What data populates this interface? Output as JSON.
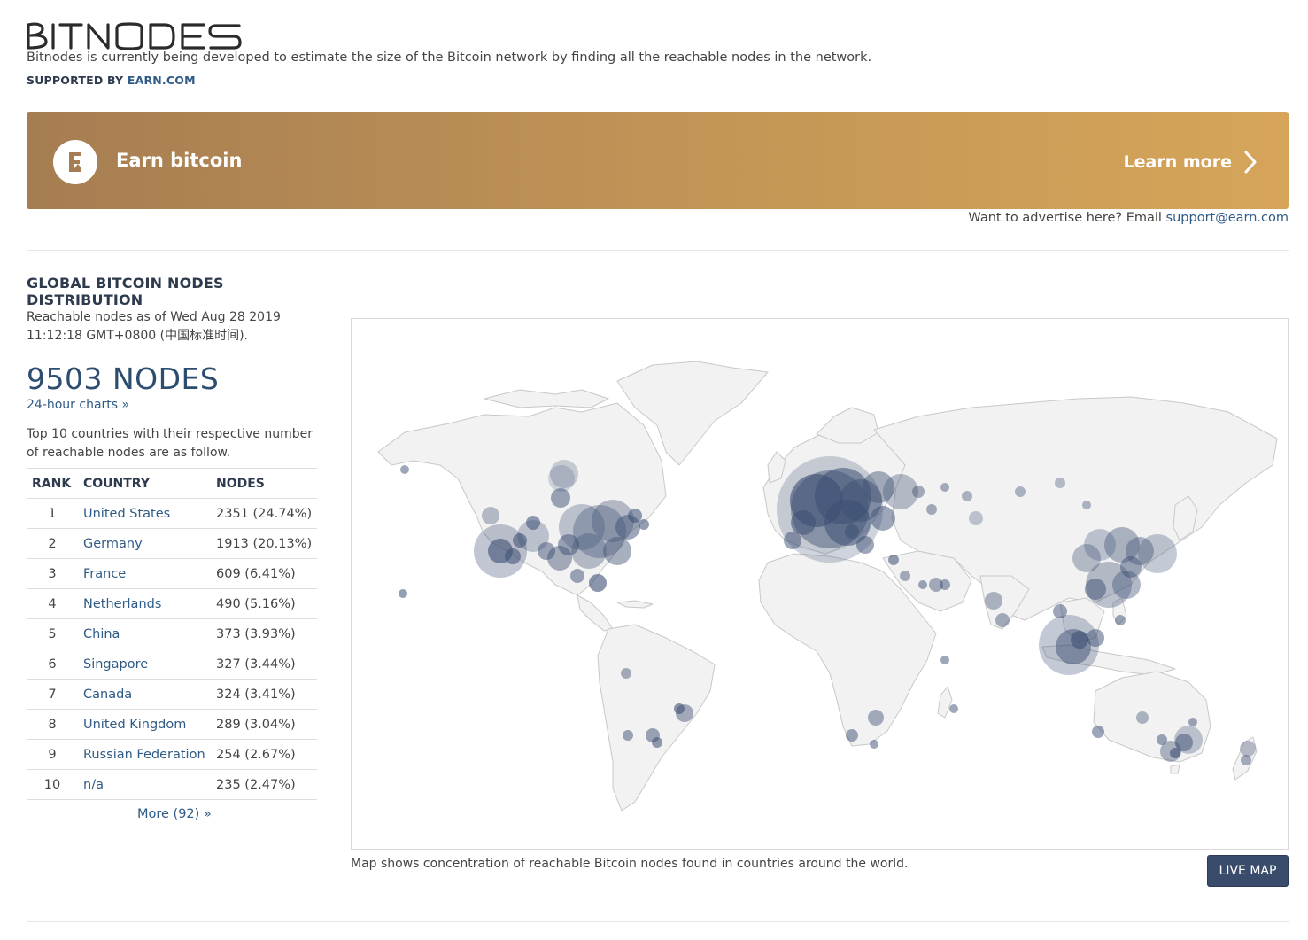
{
  "header": {
    "brand": "BITNODES",
    "tagline": "Bitnodes is currently being developed to estimate the size of the Bitcoin network by finding all the reachable nodes in the network.",
    "supported_prefix": "SUPPORTED BY",
    "supported_link": "EARN.COM"
  },
  "banner": {
    "title": "Earn bitcoin",
    "cta": "Learn more",
    "advertise_text": "Want to advertise here? Email",
    "advertise_email": "support@earn.com",
    "gradient_start": "#a67d52",
    "gradient_end": "#d6a55a"
  },
  "distribution": {
    "title": "GLOBAL BITCOIN NODES DISTRIBUTION",
    "reachable_line1": "Reachable nodes as of Wed Aug 28 2019",
    "reachable_line2": "11:12:18 GMT+0800 (中国标准时间).",
    "total": "9503 NODES",
    "charts_link": "24-hour charts »",
    "intro": "Top 10 countries with their respective number of reachable nodes are as follow.",
    "columns": [
      "RANK",
      "COUNTRY",
      "NODES"
    ],
    "rows": [
      {
        "rank": "1",
        "country": "United States",
        "nodes": "2351 (24.74%)"
      },
      {
        "rank": "2",
        "country": "Germany",
        "nodes": "1913 (20.13%)"
      },
      {
        "rank": "3",
        "country": "France",
        "nodes": "609 (6.41%)"
      },
      {
        "rank": "4",
        "country": "Netherlands",
        "nodes": "490 (5.16%)"
      },
      {
        "rank": "5",
        "country": "China",
        "nodes": "373 (3.93%)"
      },
      {
        "rank": "6",
        "country": "Singapore",
        "nodes": "327 (3.44%)"
      },
      {
        "rank": "7",
        "country": "Canada",
        "nodes": "324 (3.41%)"
      },
      {
        "rank": "8",
        "country": "United Kingdom",
        "nodes": "289 (3.04%)"
      },
      {
        "rank": "9",
        "country": "Russian Federation",
        "nodes": "254 (2.67%)"
      },
      {
        "rank": "10",
        "country": "n/a",
        "nodes": "235 (2.47%)"
      }
    ],
    "more_link": "More (92) »"
  },
  "map": {
    "caption": "Map shows concentration of reachable Bitcoin nodes found in countries around the world.",
    "live_button": "LIVE MAP",
    "land_color": "#f2f2f2",
    "border_color": "#c8c8c8",
    "bubble_color": "#3d4f73"
  }
}
